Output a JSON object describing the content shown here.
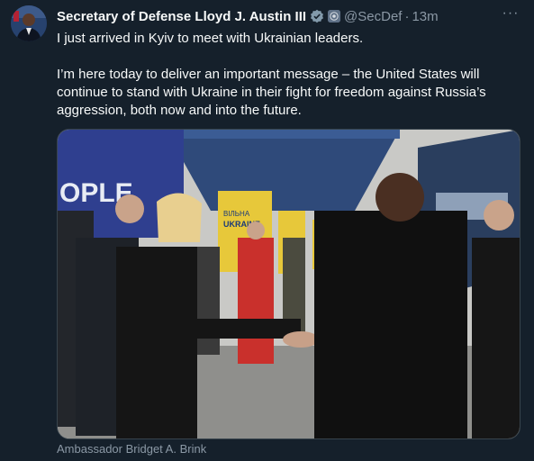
{
  "tweet": {
    "author_name": "Secretary of Defense Lloyd J. Austin III",
    "handle": "@SecDef",
    "separator": "·",
    "time": "13m",
    "more_label": "···",
    "paragraphs": [
      "I just arrived in Kyiv to meet with Ukrainian leaders.",
      "I’m here today to deliver an important message – the United States will continue to stand with Ukraine in their fight for freedom against Russia’s aggression, both now and into the future."
    ],
    "media_caption": "Ambassador Bridget A. Brink",
    "photo_signs": {
      "left_banner": "OPLE",
      "poster_lines": [
        "ВІЛЬНА",
        "UKRAINE"
      ]
    }
  },
  "colors": {
    "background": "#15202b",
    "primary_text": "#f7f9f9",
    "secondary_text": "#8b98a5",
    "verified_badge": "#829aab"
  }
}
